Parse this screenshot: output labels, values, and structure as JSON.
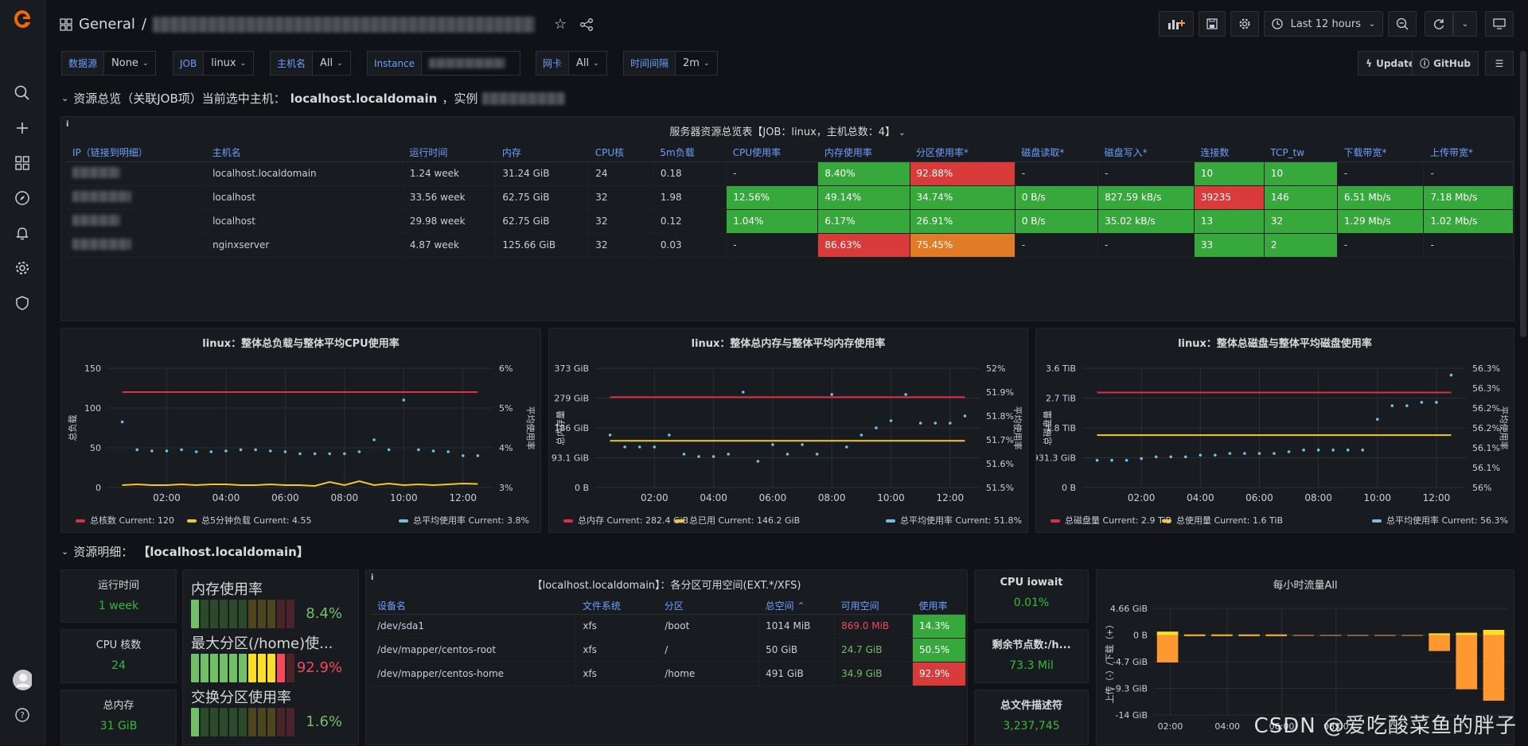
{
  "header": {
    "folder": "General",
    "separator": "/",
    "time_range": "Last 12 hours"
  },
  "variables": [
    {
      "label": "数据源",
      "value": "None"
    },
    {
      "label": "JOB",
      "value": "linux"
    },
    {
      "label": "主机名",
      "value": "All"
    },
    {
      "label": "Instance",
      "value": ""
    },
    {
      "label": "网卡",
      "value": "All"
    },
    {
      "label": "时间间隔",
      "value": "2m"
    }
  ],
  "links": {
    "update": "Update",
    "github": "GitHub"
  },
  "row1": {
    "title": "资源总览（关联JOB项）当前选中主机：",
    "host": "localhost.localdomain",
    "suffix": "，实例"
  },
  "server_table": {
    "title": "服务器资源总览表【JOB：linux，主机总数：4】",
    "headers": [
      "IP（链接到明细）",
      "主机名",
      "运行时间",
      "内存",
      "CPU核",
      "5m负载",
      "CPU使用率",
      "内存使用率",
      "分区使用率*",
      "磁盘读取*",
      "磁盘写入*",
      "连接数",
      "TCP_tw",
      "下载带宽*",
      "上传带宽*"
    ],
    "rows": [
      [
        "",
        "localhost.localdomain",
        "1.24 week",
        "31.24 GiB",
        "24",
        "0.18",
        "-",
        "8.40%",
        "92.88%",
        "-",
        "-",
        "10",
        "10",
        "-",
        "-"
      ],
      [
        "",
        "localhost",
        "33.56 week",
        "62.75 GiB",
        "32",
        "1.98",
        "12.56%",
        "49.14%",
        "34.74%",
        "0 B/s",
        "827.59 kB/s",
        "39235",
        "146",
        "6.51 Mb/s",
        "7.18 Mb/s"
      ],
      [
        "",
        "localhost",
        "29.98 week",
        "62.75 GiB",
        "32",
        "0.12",
        "1.04%",
        "6.17%",
        "26.91%",
        "0 B/s",
        "35.02 kB/s",
        "13",
        "32",
        "1.29 Mb/s",
        "1.02 Mb/s"
      ],
      [
        "",
        "nginxserver",
        "4.87 week",
        "125.66 GiB",
        "32",
        "0.03",
        "-",
        "86.63%",
        "75.45%",
        "-",
        "-",
        "33",
        "2",
        "-",
        "-"
      ]
    ],
    "cell_colors": [
      [
        "",
        "",
        "",
        "",
        "",
        "",
        "",
        "g",
        "r",
        "",
        "",
        "g",
        "g",
        "",
        ""
      ],
      [
        "",
        "",
        "",
        "",
        "",
        "",
        "g",
        "g",
        "g",
        "g",
        "g",
        "r",
        "g",
        "g",
        "g"
      ],
      [
        "",
        "",
        "",
        "",
        "",
        "",
        "g",
        "g",
        "g",
        "g",
        "g",
        "g",
        "g",
        "g",
        "g"
      ],
      [
        "",
        "",
        "",
        "",
        "",
        "",
        "",
        "r",
        "o",
        "",
        "",
        "g",
        "g",
        "",
        ""
      ]
    ]
  },
  "chart_data": [
    {
      "type": "line",
      "title": "linux：整体总负载与整体平均CPU使用率",
      "ylabel": "总负载",
      "y2label": "平均使用率",
      "x_ticks": [
        "02:00",
        "04:00",
        "06:00",
        "08:00",
        "10:00",
        "12:00"
      ],
      "y_ticks": [
        "150",
        "100",
        "50",
        "0"
      ],
      "ylim": [
        0,
        150
      ],
      "y2_ticks": [
        "6%",
        "5%",
        "4%",
        "3%"
      ],
      "y2lim": [
        3,
        6
      ],
      "x": [
        0.5,
        1,
        1.5,
        2,
        2.5,
        3,
        3.5,
        4,
        4.5,
        5,
        5.5,
        6,
        6.5,
        7,
        7.5,
        8,
        8.5,
        9,
        9.5,
        10,
        10.5,
        11,
        11.5,
        12,
        12.5
      ],
      "series": [
        {
          "name": "总核数",
          "axis": "left",
          "style": "line",
          "color": "#e02f44",
          "values": [
            120,
            120,
            120,
            120,
            120,
            120,
            120,
            120,
            120,
            120,
            120,
            120,
            120,
            120,
            120,
            120,
            120,
            120,
            120,
            120,
            120,
            120,
            120,
            120,
            120
          ]
        },
        {
          "name": "总5分钟负载",
          "axis": "left",
          "style": "line",
          "color": "#f2c730",
          "values": [
            3,
            4,
            3,
            3,
            4,
            3,
            4,
            4,
            3,
            3,
            4,
            3,
            3,
            2,
            7,
            3,
            8,
            3,
            5,
            3,
            4,
            3,
            4,
            5,
            4.55
          ]
        },
        {
          "name": "总平均使用率",
          "axis": "right",
          "style": "points",
          "color": "#73bfe6",
          "values": [
            4.65,
            3.95,
            3.92,
            3.92,
            3.95,
            3.9,
            3.9,
            3.92,
            3.95,
            3.95,
            3.92,
            3.9,
            3.85,
            3.85,
            3.85,
            3.85,
            3.9,
            4.2,
            3.95,
            5.2,
            3.95,
            3.92,
            3.9,
            3.8,
            3.8
          ]
        }
      ],
      "legend": [
        "总核数 Current: 120",
        "总5分钟负载 Current: 4.55",
        "总平均使用率 Current: 3.8%"
      ]
    },
    {
      "type": "line",
      "title": "linux：整体总内存与整体平均内存使用率",
      "ylabel": "总内存量",
      "y2label": "平均使用率",
      "x_ticks": [
        "02:00",
        "04:00",
        "06:00",
        "08:00",
        "10:00",
        "12:00"
      ],
      "y_ticks": [
        "373 GiB",
        "279 GiB",
        "186 GiB",
        "93.1 GiB",
        "0 B"
      ],
      "ylim": [
        0,
        373
      ],
      "y2_ticks": [
        "52%",
        "51.9%",
        "51.8%",
        "51.7%",
        "51.6%",
        "51.5%"
      ],
      "y2lim": [
        51.5,
        52
      ],
      "x": [
        0.5,
        1,
        1.5,
        2,
        2.5,
        3,
        3.5,
        4,
        4.5,
        5,
        5.5,
        6,
        6.5,
        7,
        7.5,
        8,
        8.5,
        9,
        9.5,
        10,
        10.5,
        11,
        11.5,
        12,
        12.5
      ],
      "series": [
        {
          "name": "总内存",
          "axis": "left",
          "style": "line",
          "color": "#e02f44",
          "values": [
            282.4,
            282.4,
            282.4,
            282.4,
            282.4,
            282.4,
            282.4,
            282.4,
            282.4,
            282.4,
            282.4,
            282.4,
            282.4,
            282.4,
            282.4,
            282.4,
            282.4,
            282.4,
            282.4,
            282.4,
            282.4,
            282.4,
            282.4,
            282.4,
            282.4
          ]
        },
        {
          "name": "总已用",
          "axis": "left",
          "style": "line",
          "color": "#f2c730",
          "values": [
            146.2,
            146.2,
            146.2,
            146.2,
            146.2,
            146.2,
            146.2,
            146.2,
            146.2,
            146.2,
            146.2,
            146.2,
            146.2,
            146.2,
            146.2,
            146.2,
            146.2,
            146.2,
            146.2,
            146.2,
            146.2,
            146.2,
            146.2,
            146.2,
            146.2
          ]
        },
        {
          "name": "总平均使用率",
          "axis": "right",
          "style": "points",
          "color": "#73bfe6",
          "values": [
            51.72,
            51.67,
            51.67,
            51.67,
            51.72,
            51.64,
            51.63,
            51.63,
            51.64,
            51.9,
            51.61,
            51.68,
            51.64,
            51.68,
            51.64,
            51.89,
            51.67,
            51.72,
            51.75,
            51.78,
            51.89,
            51.77,
            51.77,
            51.77,
            51.8
          ]
        }
      ],
      "legend": [
        "总内存 Current: 282.4 GiB",
        "总已用 Current: 146.2 GiB",
        "总平均使用率 Current: 51.8%"
      ]
    },
    {
      "type": "line",
      "title": "linux：整体总磁盘与整体平均磁盘使用率",
      "ylabel": "总磁盘量",
      "y2label": "平均使用率",
      "x_ticks": [
        "02:00",
        "04:00",
        "06:00",
        "08:00",
        "10:00",
        "12:00"
      ],
      "y_ticks": [
        "3.6 TiB",
        "2.7 TiB",
        "1.8 TiB",
        "931.3 GiB",
        "0 B"
      ],
      "ylim": [
        0,
        3.64
      ],
      "y2_ticks": [
        "56.3%",
        "56.3%",
        "56.2%",
        "56.2%",
        "56.1%",
        "56.1%",
        "56%"
      ],
      "y2lim": [
        56.0,
        56.35
      ],
      "x": [
        0.5,
        1,
        1.5,
        2,
        2.5,
        3,
        3.5,
        4,
        4.5,
        5,
        5.5,
        6,
        6.5,
        7,
        7.5,
        8,
        8.5,
        9,
        9.5,
        10,
        10.5,
        11,
        11.5,
        12,
        12.5
      ],
      "series": [
        {
          "name": "总磁盘量",
          "axis": "left",
          "style": "line",
          "color": "#e02f44",
          "values": [
            2.9,
            2.9,
            2.9,
            2.9,
            2.9,
            2.9,
            2.9,
            2.9,
            2.9,
            2.9,
            2.9,
            2.9,
            2.9,
            2.9,
            2.9,
            2.9,
            2.9,
            2.9,
            2.9,
            2.9,
            2.9,
            2.9,
            2.9,
            2.9,
            2.9
          ]
        },
        {
          "name": "总使用量",
          "axis": "left",
          "style": "line",
          "color": "#f2c730",
          "values": [
            1.6,
            1.6,
            1.6,
            1.6,
            1.6,
            1.6,
            1.6,
            1.6,
            1.6,
            1.6,
            1.6,
            1.6,
            1.6,
            1.6,
            1.6,
            1.6,
            1.6,
            1.6,
            1.6,
            1.6,
            1.6,
            1.6,
            1.6,
            1.6,
            1.6
          ]
        },
        {
          "name": "总平均使用率",
          "axis": "right",
          "style": "points",
          "color": "#73bfe6",
          "values": [
            56.08,
            56.08,
            56.08,
            56.085,
            56.09,
            56.09,
            56.09,
            56.095,
            56.095,
            56.1,
            56.1,
            56.1,
            56.1,
            56.105,
            56.11,
            56.11,
            56.11,
            56.11,
            56.11,
            56.2,
            56.24,
            56.24,
            56.25,
            56.25,
            56.33
          ]
        }
      ],
      "legend": [
        "总磁盘量 Current: 2.9 TiB",
        "总使用量 Current: 1.6 TiB",
        "总平均使用率 Current: 56.3%"
      ]
    },
    {
      "type": "bar",
      "title": "每小时流量All",
      "ylabel": "上传（-）/下载（+）",
      "y_ticks": [
        "4.66 GiB",
        "0 B",
        "-4.7 GiB",
        "-9.3 GiB",
        "-14 GiB"
      ],
      "ylim": [
        -14,
        4.66
      ],
      "x_ticks": [
        "02:00",
        "04:00",
        "06:00",
        "08:00"
      ],
      "x": [
        1,
        2,
        3,
        4,
        5,
        6,
        7,
        8,
        9,
        10,
        11,
        12,
        13
      ],
      "series": [
        {
          "name": "上传",
          "color": "#ff9830",
          "values": [
            -4.8,
            -0.2,
            -0.2,
            -0.2,
            -0.2,
            -0.1,
            -0.1,
            -0.1,
            -0.1,
            -0.1,
            -2.8,
            -9.5,
            -11.5
          ]
        },
        {
          "name": "下载",
          "color": "#fade2a",
          "values": [
            0.6,
            0.1,
            0.1,
            0.1,
            0.1,
            0,
            0,
            0,
            0,
            0,
            0.3,
            0.4,
            0.9
          ]
        }
      ]
    }
  ],
  "row2": {
    "title": "资源明细：",
    "host": "【localhost.localdomain】"
  },
  "stats": {
    "uptime": {
      "label": "运行时间",
      "value": "1 week"
    },
    "cpu_cores": {
      "label": "CPU 核数",
      "value": "24"
    },
    "total_mem": {
      "label": "总内存",
      "value": "31 GiB"
    },
    "iowait": {
      "label": "CPU iowait",
      "value": "0.01%"
    },
    "inodes": {
      "label": "剩余节点数:/h...",
      "value": "73.3 Mil"
    },
    "fd": {
      "label": "总文件描述符",
      "value": "3,237,745"
    }
  },
  "gauges": [
    {
      "name": "内存使用率",
      "value": "8.4%",
      "fraction": 0.084,
      "color": "#73bf69"
    },
    {
      "name": "最大分区(/home)使...",
      "value": "92.9%",
      "fraction": 0.929,
      "color": "#f2495c"
    },
    {
      "name": "交换分区使用率",
      "value": "1.6%",
      "fraction": 0.016,
      "color": "#73bf69"
    }
  ],
  "disk_table": {
    "title": "【localhost.localdomain】：各分区可用空间(EXT.*/XFS)",
    "headers": [
      "设备名",
      "文件系统",
      "分区",
      "总空间 ⌃",
      "可用空间",
      "使用率"
    ],
    "rows": [
      [
        "/dev/sda1",
        "xfs",
        "/boot",
        "1014 MiB",
        "869.0 MiB",
        "14.3%"
      ],
      [
        "/dev/mapper/centos-root",
        "xfs",
        "/",
        "50 GiB",
        "24.7 GiB",
        "50.5%"
      ],
      [
        "/dev/mapper/centos-home",
        "xfs",
        "/home",
        "491 GiB",
        "34.9 GiB",
        "92.9%"
      ]
    ],
    "avail_colors": [
      "#f2495c",
      "#73bf69",
      "#73bf69"
    ],
    "usage_colors": [
      "#37a93c",
      "#37a93c",
      "#d93a3a"
    ]
  },
  "watermark": "CSDN @爱吃酸菜鱼的胖子"
}
